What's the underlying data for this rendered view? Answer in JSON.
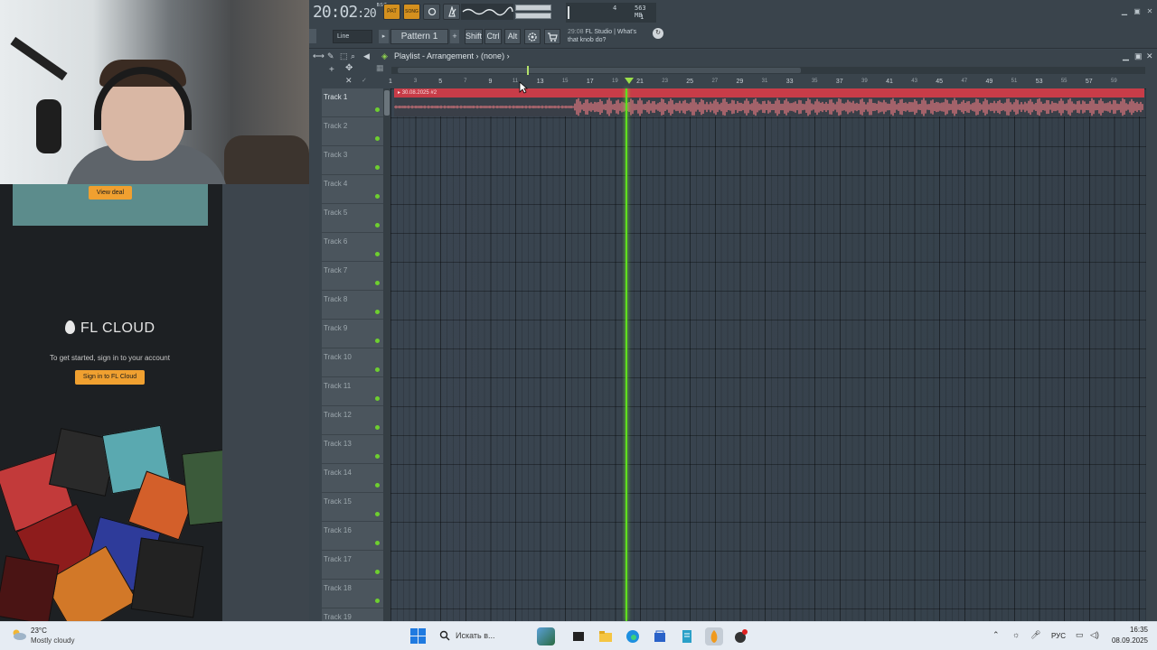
{
  "left_panel": {
    "ad": {
      "cta": "View deal"
    },
    "cloud": {
      "brand": "FL CLOUD",
      "prompt": "To get started, sign in to your account",
      "sign_in": "Sign in to FL Cloud"
    }
  },
  "toolbar": {
    "clock": {
      "main": "20:02",
      "sec": ":20",
      "tiny": "B:S:T"
    },
    "mode_pattern": "PAT",
    "mode_song": "SONG",
    "cpu": {
      "poly": "4",
      "mem": "563 MB",
      "voices": "1"
    },
    "snap": "Line",
    "pattern": "Pattern 1",
    "pattern_add": "+",
    "shift": "Shift",
    "ctrl": "Ctrl",
    "alt": "Alt",
    "news": {
      "date": "29:08",
      "line1": "FL Studio | What's",
      "line2": "that knob do?"
    }
  },
  "playlist": {
    "title": "Playlist - Arrangement",
    "pattern": "(none)",
    "bar_labels": [
      "1",
      "3",
      "5",
      "7",
      "9",
      "11",
      "13",
      "15",
      "17",
      "19",
      "21",
      "23",
      "25",
      "27",
      "29",
      "31",
      "33",
      "35",
      "37",
      "39",
      "41",
      "43",
      "45",
      "47",
      "49",
      "51",
      "53",
      "55",
      "57",
      "59"
    ],
    "tracks": [
      "Track 1",
      "Track 2",
      "Track 3",
      "Track 4",
      "Track 5",
      "Track 6",
      "Track 7",
      "Track 8",
      "Track 9",
      "Track 10",
      "Track 11",
      "Track 12",
      "Track 13",
      "Track 14",
      "Track 15",
      "Track 16",
      "Track 17",
      "Track 18",
      "Track 19"
    ],
    "clip": {
      "name": "30.08.2025 #2",
      "color": "#e87a80"
    },
    "playhead_bar": 20,
    "accent_color": "#5fe01e"
  },
  "taskbar": {
    "weather": {
      "temp": "23°C",
      "desc": "Mostly cloudy"
    },
    "search_placeholder": "Искать в...",
    "lang": "РУС",
    "time": "16:35",
    "date": "08.09.2025"
  }
}
